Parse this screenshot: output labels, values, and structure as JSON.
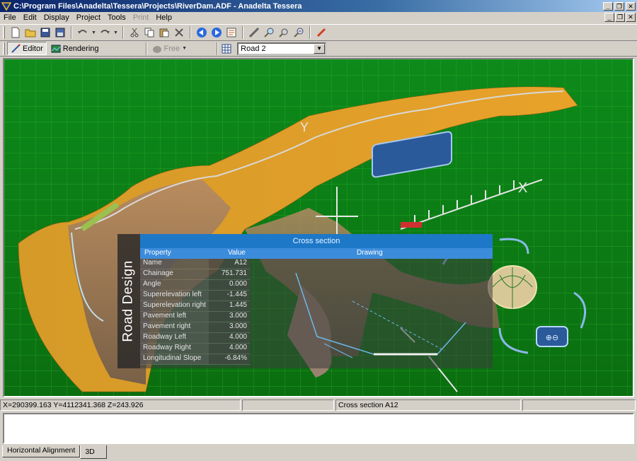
{
  "window": {
    "title": "C:\\Program Files\\Anadelta\\Tessera\\Projects\\RiverDam.ADF - Anadelta Tessera",
    "minimize": "_",
    "restore": "❐",
    "close": "✕"
  },
  "menu": [
    {
      "label": "File"
    },
    {
      "label": "Edit"
    },
    {
      "label": "Display"
    },
    {
      "label": "Project"
    },
    {
      "label": "Tools"
    },
    {
      "label": "Print",
      "disabled": true
    },
    {
      "label": "Help"
    }
  ],
  "toolbar": {
    "icons": [
      "new-icon",
      "open-icon",
      "save-icon",
      "save-as-icon",
      "undo-icon",
      "redo-icon",
      "cut-icon",
      "copy-icon",
      "paste-icon",
      "delete-icon",
      "back-icon",
      "forward-icon",
      "properties-icon",
      "measure-icon",
      "zoom-icon",
      "zoom-window-icon",
      "zoom-out-icon",
      "pen-icon"
    ]
  },
  "modes": {
    "editor": "Editor",
    "rendering": "Rendering",
    "free": "Free"
  },
  "road_select": {
    "value": "Road 2"
  },
  "scene": {
    "axis_x": "X",
    "axis_y": "Y",
    "road_label": "Road 2",
    "grid_color": "#1a9e1a"
  },
  "cross_section": {
    "side_title": "Road Design",
    "header": "Cross section",
    "col_property": "Property",
    "col_value": "Value",
    "col_drawing": "Drawing",
    "rows": [
      {
        "k": "Name",
        "v": "A12"
      },
      {
        "k": "Chainage",
        "v": "751.731"
      },
      {
        "k": "Angle",
        "v": "0.000"
      },
      {
        "k": "Superelevation left",
        "v": "-1.445"
      },
      {
        "k": "Superelevation right",
        "v": "1.445"
      },
      {
        "k": "Pavement left",
        "v": "3.000"
      },
      {
        "k": "Pavement right",
        "v": "3.000"
      },
      {
        "k": "Roadway Left",
        "v": "4.000"
      },
      {
        "k": "Roadway Right",
        "v": "4.000"
      },
      {
        "k": "Longitudinal Slope",
        "v": "-6.84%"
      }
    ]
  },
  "status": {
    "coords": "X=290399.163  Y=4112341.368  Z=243.926",
    "pane2": "",
    "pane3": "Cross section A12",
    "pane4": ""
  },
  "tabs": [
    {
      "label": "Horizontal Alignment"
    },
    {
      "label": "3D",
      "active": true
    }
  ]
}
